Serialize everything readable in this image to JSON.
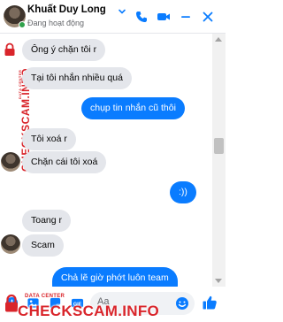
{
  "header": {
    "name": "Khuất Duy Long",
    "status": "Đang hoạt động",
    "accent": "#0a7cff"
  },
  "messages": [
    {
      "side": "in",
      "text": "Ông ý chặn tôi r"
    },
    {
      "side": "in",
      "text": "Tại tôi nhắn nhiều quá"
    },
    {
      "side": "out",
      "text": "chụp tin nhắn cũ thôi"
    },
    {
      "side": "in",
      "text": "Tôi xoá r"
    },
    {
      "side": "in",
      "text": "Chặn cái tôi xoá"
    },
    {
      "side": "out",
      "text": ":))"
    },
    {
      "side": "in",
      "text": "Toang r"
    },
    {
      "side": "in",
      "text": "Scam"
    },
    {
      "side": "out",
      "text": "Chả lẽ giờ phớt luôn team"
    }
  ],
  "composer": {
    "placeholder": "Aa"
  },
  "watermark": {
    "small": "DATA CENTER",
    "big": "CHECKSCAM.INFO",
    "color": "#d9252b"
  },
  "icons": [
    "chevron-down-icon",
    "phone-icon",
    "video-icon",
    "minimize-icon",
    "close-icon",
    "plus-circle-icon",
    "image-icon",
    "sticker-icon",
    "gif-icon",
    "emoji-icon",
    "like-icon"
  ]
}
